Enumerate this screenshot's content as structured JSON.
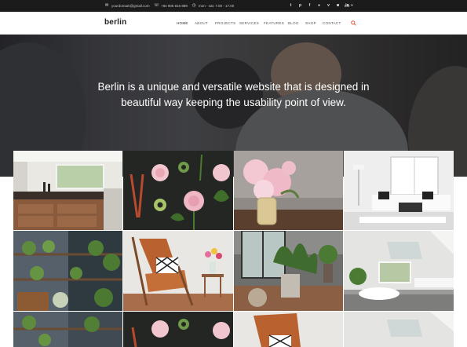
{
  "topbar": {
    "email": "yourdomain@gmail.com",
    "phone": "+84 905 816 889",
    "hours": "mon - sat: 7.00 - 17.00",
    "social_icons": [
      "twitter-icon",
      "pinterest-icon",
      "facebook-icon",
      "flickr-icon",
      "vimeo-icon",
      "instagram-icon",
      "linkedin-icon"
    ],
    "language": "EN"
  },
  "header": {
    "logo": "berlin",
    "nav": [
      "HOME",
      "ABOUT",
      "PROJECTS",
      "SERVICES",
      "FEATURES",
      "BLOG",
      "SHOP",
      "CONTACT"
    ],
    "active_nav": "HOME"
  },
  "hero": {
    "line1": "Berlin is a unique and versatile website that is designed in",
    "line2": "beautiful way keeping the usability point of view."
  },
  "gallery": {
    "tiles": [
      "kitchen-photo",
      "pink-flowers-scissors-photo",
      "peony-vase-photo",
      "white-living-room-photo",
      "plant-shelves-photo",
      "leather-chair-photo",
      "plants-interior-photo",
      "white-bathroom-photo",
      "plant-shelves-photo",
      "pink-flowers-scissors-photo",
      "leather-chair-photo",
      "white-bathroom-photo"
    ]
  },
  "colors": {
    "topbar_bg": "#1b1b1b",
    "accent": "#e0533a"
  }
}
